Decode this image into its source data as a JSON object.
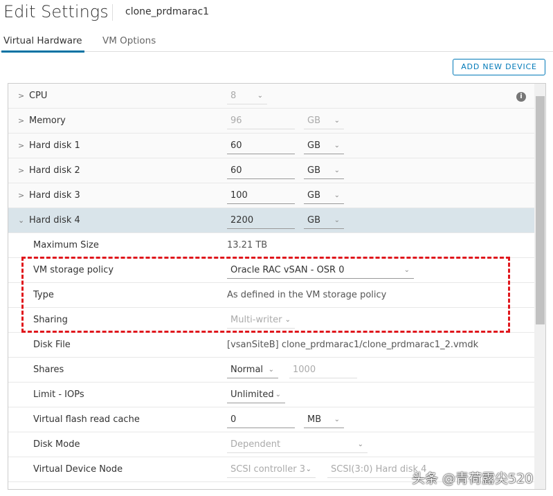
{
  "header": {
    "title": "Edit Settings",
    "vm_name": "clone_prdmarac1"
  },
  "tabs": [
    {
      "label": "Virtual Hardware"
    },
    {
      "label": "VM Options"
    }
  ],
  "add_device_label": "ADD NEW DEVICE",
  "rows": {
    "cpu": {
      "label": "CPU",
      "value": "8"
    },
    "memory": {
      "label": "Memory",
      "value": "96",
      "unit": "GB"
    },
    "hd1": {
      "label": "Hard disk 1",
      "value": "60",
      "unit": "GB"
    },
    "hd2": {
      "label": "Hard disk 2",
      "value": "60",
      "unit": "GB"
    },
    "hd3": {
      "label": "Hard disk 3",
      "value": "100",
      "unit": "GB"
    },
    "hd4": {
      "label": "Hard disk 4",
      "value": "2200",
      "unit": "GB"
    },
    "max_size": {
      "label": "Maximum Size",
      "value": "13.21 TB"
    },
    "policy": {
      "label": "VM storage policy",
      "value": "Oracle RAC vSAN - OSR 0"
    },
    "type": {
      "label": "Type",
      "value": "As defined in the VM storage policy"
    },
    "sharing": {
      "label": "Sharing",
      "value": "Multi-writer"
    },
    "disk_file": {
      "label": "Disk File",
      "value": "[vsanSiteB] clone_prdmarac1/clone_prdmarac1_2.vmdk"
    },
    "shares": {
      "label": "Shares",
      "value": "Normal",
      "amount": "1000"
    },
    "limit": {
      "label": "Limit - IOPs",
      "value": "Unlimited"
    },
    "flash": {
      "label": "Virtual flash read cache",
      "value": "0",
      "unit": "MB"
    },
    "mode": {
      "label": "Disk Mode",
      "value": "Dependent"
    },
    "node": {
      "label": "Virtual Device Node",
      "controller": "SCSI controller 3",
      "slot": "SCSI(3:0) Hard disk 4"
    }
  },
  "watermark": "头条 @青荷露尖520"
}
